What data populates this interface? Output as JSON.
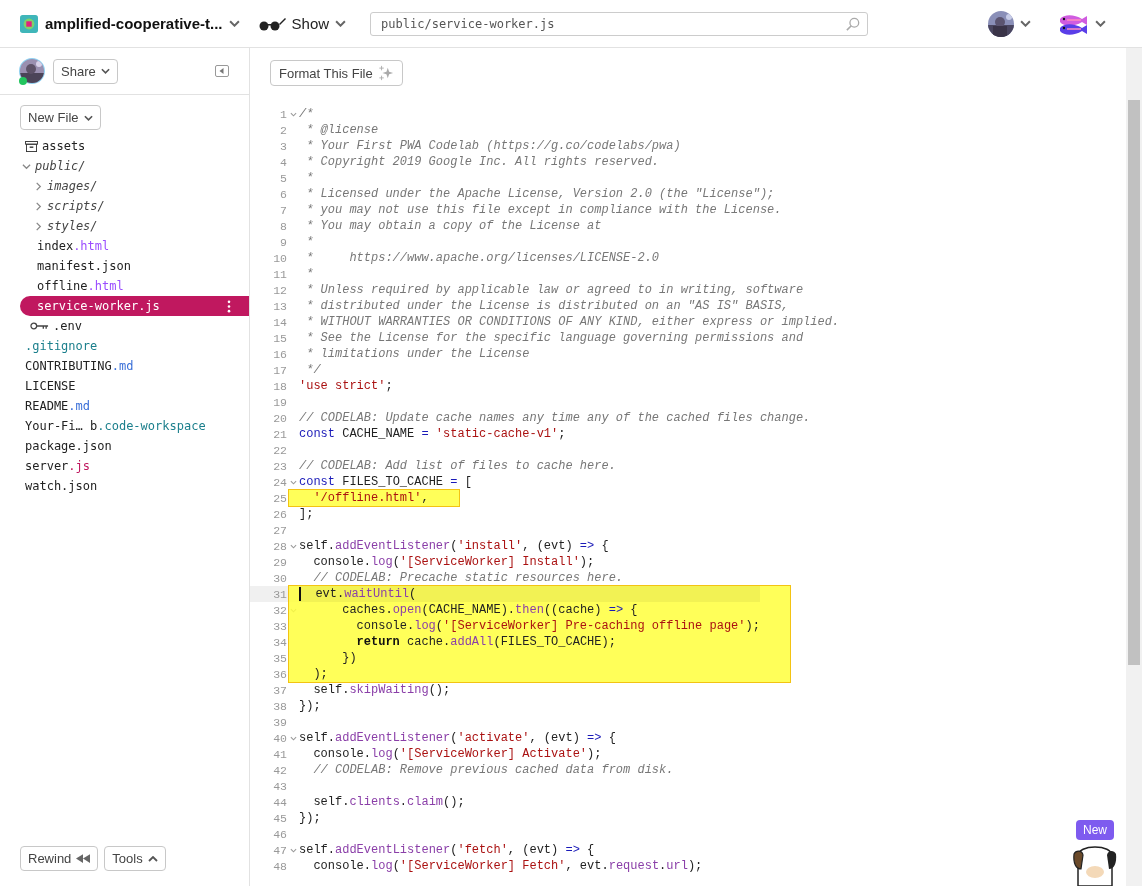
{
  "top_bar": {
    "project_name": "amplified-cooperative-t...",
    "show_label": "Show",
    "path_field": {
      "value": "public/service-worker.js"
    }
  },
  "user": {
    "online": true
  },
  "sidebar": {
    "share_label": "Share",
    "new_file_label": "New File",
    "tree": [
      {
        "kind": "assets",
        "name": "assets"
      },
      {
        "kind": "folder",
        "name": "public/",
        "expanded": true,
        "children": [
          {
            "kind": "folder",
            "name": "images/",
            "expanded": false
          },
          {
            "kind": "folder",
            "name": "scripts/",
            "expanded": false
          },
          {
            "kind": "folder",
            "name": "styles/",
            "expanded": false
          },
          {
            "kind": "file",
            "name": "index",
            "ext": {
              "text": ".html",
              "color": "#9b4dff"
            },
            "selected": false
          },
          {
            "kind": "file",
            "name": "manifest.json",
            "selected": false
          },
          {
            "kind": "file",
            "name": "offline",
            "ext": {
              "text": ".html",
              "color": "#9b4dff"
            },
            "selected": false
          },
          {
            "kind": "file",
            "name": "service-worker.js",
            "selected": true
          }
        ]
      },
      {
        "kind": "secret",
        "name": ".env"
      },
      {
        "kind": "file",
        "ext": {
          "text": ".gitignore",
          "color": "#1b7f8c"
        },
        "selected": false
      },
      {
        "kind": "file",
        "name": "CONTRIBUTING",
        "ext": {
          "text": ".md",
          "color": "#3a6fd8"
        },
        "selected": false
      },
      {
        "kind": "file",
        "name": "LICENSE",
        "selected": false
      },
      {
        "kind": "file",
        "name": "README",
        "ext": {
          "text": ".md",
          "color": "#3a6fd8"
        },
        "selected": false
      },
      {
        "kind": "file",
        "name": "Your-Fi… b",
        "ext": {
          "text": ".code-workspace",
          "color": "#1b7f8c"
        },
        "selected": false
      },
      {
        "kind": "file",
        "name": "package.json",
        "selected": false
      },
      {
        "kind": "file",
        "name": "server",
        "ext": {
          "text": ".js",
          "color": "#c0185f"
        },
        "selected": false
      },
      {
        "kind": "file",
        "name": "watch.json",
        "selected": false
      }
    ],
    "rewind_label": "Rewind",
    "tools_label": "Tools"
  },
  "editor": {
    "format_label": "Format This File",
    "blocks": [
      {
        "highlight": false,
        "lines": [
          {
            "number": "1",
            "fold": true,
            "current": false,
            "tokens": [
              {
                "kind": "comment",
                "text": "/*"
              }
            ]
          },
          {
            "number": "2",
            "fold": false,
            "current": false,
            "tokens": [
              {
                "kind": "comment",
                "text": " * @license"
              }
            ]
          },
          {
            "number": "3",
            "fold": false,
            "current": false,
            "tokens": [
              {
                "kind": "comment",
                "text": " * Your First PWA Codelab (https://g.co/codelabs/pwa)"
              }
            ]
          },
          {
            "number": "4",
            "fold": false,
            "current": false,
            "tokens": [
              {
                "kind": "comment",
                "text": " * Copyright 2019 Google Inc. All rights reserved."
              }
            ]
          },
          {
            "number": "5",
            "fold": false,
            "current": false,
            "tokens": [
              {
                "kind": "comment",
                "text": " *"
              }
            ]
          },
          {
            "number": "6",
            "fold": false,
            "current": false,
            "tokens": [
              {
                "kind": "comment",
                "text": " * Licensed under the Apache License, Version 2.0 (the \"License\");"
              }
            ]
          },
          {
            "number": "7",
            "fold": false,
            "current": false,
            "tokens": [
              {
                "kind": "comment",
                "text": " * you may not use this file except in compliance with the License."
              }
            ]
          },
          {
            "number": "8",
            "fold": false,
            "current": false,
            "tokens": [
              {
                "kind": "comment",
                "text": " * You may obtain a copy of the License at"
              }
            ]
          },
          {
            "number": "9",
            "fold": false,
            "current": false,
            "tokens": [
              {
                "kind": "comment",
                "text": " *"
              }
            ]
          },
          {
            "number": "10",
            "fold": false,
            "current": false,
            "tokens": [
              {
                "kind": "comment",
                "text": " *     https://www.apache.org/licenses/LICENSE-2.0"
              }
            ]
          },
          {
            "number": "11",
            "fold": false,
            "current": false,
            "tokens": [
              {
                "kind": "comment",
                "text": " *"
              }
            ]
          },
          {
            "number": "12",
            "fold": false,
            "current": false,
            "tokens": [
              {
                "kind": "comment",
                "text": " * Unless required by applicable law or agreed to in writing, software"
              }
            ]
          },
          {
            "number": "13",
            "fold": false,
            "current": false,
            "tokens": [
              {
                "kind": "comment",
                "text": " * distributed under the License is distributed on an \"AS IS\" BASIS,"
              }
            ]
          },
          {
            "number": "14",
            "fold": false,
            "current": false,
            "tokens": [
              {
                "kind": "comment",
                "text": " * WITHOUT WARRANTIES OR CONDITIONS OF ANY KIND, either express or implied."
              }
            ]
          },
          {
            "number": "15",
            "fold": false,
            "current": false,
            "tokens": [
              {
                "kind": "comment",
                "text": " * See the License for the specific language governing permissions and"
              }
            ]
          },
          {
            "number": "16",
            "fold": false,
            "current": false,
            "tokens": [
              {
                "kind": "comment",
                "text": " * limitations under the License"
              }
            ]
          },
          {
            "number": "17",
            "fold": false,
            "current": false,
            "tokens": [
              {
                "kind": "comment",
                "text": " */"
              }
            ]
          },
          {
            "number": "18",
            "fold": false,
            "current": false,
            "tokens": [
              {
                "kind": "string",
                "text": "'use strict'"
              },
              {
                "kind": "plain",
                "text": ";"
              }
            ]
          },
          {
            "number": "19",
            "fold": false,
            "current": false
          },
          {
            "number": "20",
            "fold": false,
            "current": false,
            "tokens": [
              {
                "kind": "comment",
                "text": "// CODELAB: Update cache names any time any of the cached files change."
              }
            ]
          },
          {
            "number": "21",
            "fold": false,
            "current": false,
            "tokens": [
              {
                "kind": "keyword",
                "text": "const"
              },
              {
                "kind": "plain",
                "text": " CACHE_NAME "
              },
              {
                "kind": "keyword",
                "text": "= "
              },
              {
                "kind": "string",
                "text": "'static-cache-v1'"
              },
              {
                "kind": "plain",
                "text": ";"
              }
            ]
          },
          {
            "number": "22",
            "fold": false,
            "current": false
          },
          {
            "number": "23",
            "fold": false,
            "current": false,
            "tokens": [
              {
                "kind": "comment",
                "text": "// CODELAB: Add list of files to cache here."
              }
            ]
          },
          {
            "number": "24",
            "fold": true,
            "current": false,
            "tokens": [
              {
                "kind": "keyword",
                "text": "const"
              },
              {
                "kind": "plain",
                "text": " FILES_TO_CACHE "
              },
              {
                "kind": "keyword",
                "text": "="
              },
              {
                "kind": "plain",
                "text": " ["
              }
            ]
          }
        ]
      },
      {
        "highlight": true,
        "lines": [
          {
            "number": "25",
            "fold": false,
            "current": false,
            "tokens": [
              {
                "kind": "string",
                "text": "  '/offline.html'"
              },
              {
                "kind": "plain",
                "text": ","
              }
            ]
          }
        ]
      },
      {
        "highlight": false,
        "lines": [
          {
            "number": "26",
            "fold": false,
            "current": false,
            "tokens": [
              {
                "kind": "plain",
                "text": "];"
              }
            ]
          },
          {
            "number": "27",
            "fold": false,
            "current": false
          },
          {
            "number": "28",
            "fold": true,
            "current": false,
            "tokens": [
              {
                "kind": "plain",
                "text": "self."
              },
              {
                "kind": "method",
                "text": "addEventListener"
              },
              {
                "kind": "plain",
                "text": "("
              },
              {
                "kind": "string",
                "text": "'install'"
              },
              {
                "kind": "plain",
                "text": ", (evt) "
              },
              {
                "kind": "keyword",
                "text": "=>"
              },
              {
                "kind": "plain",
                "text": " {"
              }
            ]
          },
          {
            "number": "29",
            "fold": false,
            "current": false,
            "tokens": [
              {
                "kind": "plain",
                "text": "  console."
              },
              {
                "kind": "method",
                "text": "log"
              },
              {
                "kind": "plain",
                "text": "("
              },
              {
                "kind": "string",
                "text": "'[ServiceWorker] Install'"
              },
              {
                "kind": "plain",
                "text": ");"
              }
            ]
          },
          {
            "number": "30",
            "fold": false,
            "current": false,
            "tokens": [
              {
                "kind": "comment",
                "text": "  // CODELAB: Precache static resources here."
              }
            ]
          }
        ]
      },
      {
        "highlight": true,
        "lines": [
          {
            "number": "31",
            "fold": false,
            "current": true,
            "tokens": [
              {
                "kind": "plain",
                "text": "  evt."
              },
              {
                "kind": "method",
                "text": "waitUntil"
              },
              {
                "kind": "plain",
                "text": "("
              }
            ]
          },
          {
            "number": "32",
            "fold": true,
            "current": false,
            "tokens": [
              {
                "kind": "plain",
                "text": "      caches."
              },
              {
                "kind": "method",
                "text": "open"
              },
              {
                "kind": "plain",
                "text": "(CACHE_NAME)."
              },
              {
                "kind": "method",
                "text": "then"
              },
              {
                "kind": "plain",
                "text": "((cache) "
              },
              {
                "kind": "keyword",
                "text": "=>"
              },
              {
                "kind": "plain",
                "text": " {"
              }
            ]
          },
          {
            "number": "33",
            "fold": false,
            "current": false,
            "tokens": [
              {
                "kind": "plain",
                "text": "        console."
              },
              {
                "kind": "method",
                "text": "log"
              },
              {
                "kind": "plain",
                "text": "("
              },
              {
                "kind": "string",
                "text": "'[ServiceWorker] Pre-caching offline page'"
              },
              {
                "kind": "plain",
                "text": ");"
              }
            ]
          },
          {
            "number": "34",
            "fold": false,
            "current": false,
            "tokens": [
              {
                "kind": "bold",
                "text": "        return"
              },
              {
                "kind": "plain",
                "text": " cache."
              },
              {
                "kind": "method",
                "text": "addAll"
              },
              {
                "kind": "plain",
                "text": "(FILES_TO_CACHE);"
              }
            ]
          },
          {
            "number": "35",
            "fold": false,
            "current": false,
            "tokens": [
              {
                "kind": "plain",
                "text": "      })"
              }
            ]
          },
          {
            "number": "36",
            "fold": false,
            "current": false,
            "tokens": [
              {
                "kind": "plain",
                "text": "  );"
              }
            ]
          }
        ]
      },
      {
        "highlight": false,
        "lines": [
          {
            "number": "37",
            "fold": false,
            "current": false,
            "tokens": [
              {
                "kind": "plain",
                "text": "  self."
              },
              {
                "kind": "method",
                "text": "skipWaiting"
              },
              {
                "kind": "plain",
                "text": "();"
              }
            ]
          },
          {
            "number": "38",
            "fold": false,
            "current": false,
            "tokens": [
              {
                "kind": "plain",
                "text": "});"
              }
            ]
          },
          {
            "number": "39",
            "fold": false,
            "current": false
          },
          {
            "number": "40",
            "fold": true,
            "current": false,
            "tokens": [
              {
                "kind": "plain",
                "text": "self."
              },
              {
                "kind": "method",
                "text": "addEventListener"
              },
              {
                "kind": "plain",
                "text": "("
              },
              {
                "kind": "string",
                "text": "'activate'"
              },
              {
                "kind": "plain",
                "text": ", (evt) "
              },
              {
                "kind": "keyword",
                "text": "=>"
              },
              {
                "kind": "plain",
                "text": " {"
              }
            ]
          },
          {
            "number": "41",
            "fold": false,
            "current": false,
            "tokens": [
              {
                "kind": "plain",
                "text": "  console."
              },
              {
                "kind": "method",
                "text": "log"
              },
              {
                "kind": "plain",
                "text": "("
              },
              {
                "kind": "string",
                "text": "'[ServiceWorker] Activate'"
              },
              {
                "kind": "plain",
                "text": ");"
              }
            ]
          },
          {
            "number": "42",
            "fold": false,
            "current": false,
            "tokens": [
              {
                "kind": "comment",
                "text": "  // CODELAB: Remove previous cached data from disk."
              }
            ]
          },
          {
            "number": "43",
            "fold": false,
            "current": false
          },
          {
            "number": "44",
            "fold": false,
            "current": false,
            "tokens": [
              {
                "kind": "plain",
                "text": "  self."
              },
              {
                "kind": "method",
                "text": "clients"
              },
              {
                "kind": "plain",
                "text": "."
              },
              {
                "kind": "method",
                "text": "claim"
              },
              {
                "kind": "plain",
                "text": "();"
              }
            ]
          },
          {
            "number": "45",
            "fold": false,
            "current": false,
            "tokens": [
              {
                "kind": "plain",
                "text": "});"
              }
            ]
          },
          {
            "number": "46",
            "fold": false,
            "current": false
          },
          {
            "number": "47",
            "fold": true,
            "current": false,
            "tokens": [
              {
                "kind": "plain",
                "text": "self."
              },
              {
                "kind": "method",
                "text": "addEventListener"
              },
              {
                "kind": "plain",
                "text": "("
              },
              {
                "kind": "string",
                "text": "'fetch'"
              },
              {
                "kind": "plain",
                "text": ", (evt) "
              },
              {
                "kind": "keyword",
                "text": "=>"
              },
              {
                "kind": "plain",
                "text": " {"
              }
            ]
          },
          {
            "number": "48",
            "fold": false,
            "current": false,
            "tokens": [
              {
                "kind": "plain",
                "text": "  console."
              },
              {
                "kind": "method",
                "text": "log"
              },
              {
                "kind": "plain",
                "text": "("
              },
              {
                "kind": "string",
                "text": "'[ServiceWorker] Fetch'"
              },
              {
                "kind": "plain",
                "text": ", evt."
              },
              {
                "kind": "method",
                "text": "request"
              },
              {
                "kind": "plain",
                "text": "."
              },
              {
                "kind": "method",
                "text": "url"
              },
              {
                "kind": "plain",
                "text": ");"
              }
            ]
          }
        ]
      }
    ]
  },
  "help": {
    "badge": "New"
  }
}
